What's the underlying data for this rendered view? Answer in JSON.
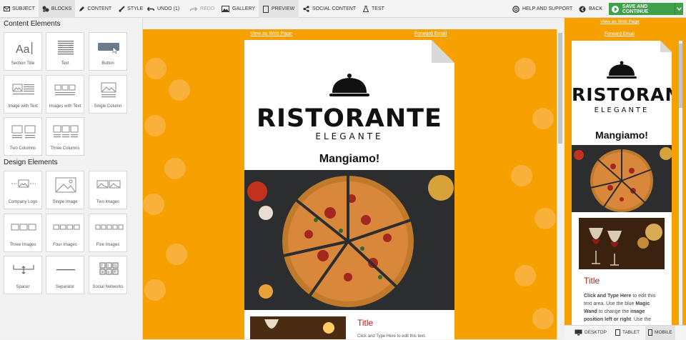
{
  "left_tabs": [
    {
      "label": "Subject",
      "icon": "envelope-icon"
    },
    {
      "label": "Blocks",
      "icon": "blocks-icon"
    },
    {
      "label": "Content",
      "icon": "pencil-icon"
    },
    {
      "label": "Style",
      "icon": "brush-icon"
    }
  ],
  "toolbar": {
    "undo": "Undo (1)",
    "redo": "Redo",
    "gallery": "Gallery",
    "preview": "Preview",
    "social": "Social Content",
    "test": "Test",
    "help": "Help and Support",
    "back": "Back",
    "save": "Save and Continue"
  },
  "sidebar": {
    "content_heading": "Content Elements",
    "content_blocks": [
      {
        "label": "Section Title",
        "icon": "section-title-icon"
      },
      {
        "label": "Text",
        "icon": "text-block-icon"
      },
      {
        "label": "Button",
        "icon": "button-block-icon"
      },
      {
        "label": "Image with Text",
        "icon": "image-with-text-icon"
      },
      {
        "label": "Images with Text",
        "icon": "images-with-text-icon"
      },
      {
        "label": "Single Column",
        "icon": "single-column-icon"
      },
      {
        "label": "Two Columns",
        "icon": "two-columns-icon"
      },
      {
        "label": "Three Columns",
        "icon": "three-columns-icon"
      }
    ],
    "design_heading": "Design Elements",
    "design_blocks": [
      {
        "label": "Company Logo",
        "icon": "company-logo-icon"
      },
      {
        "label": "Single Image",
        "icon": "single-image-icon"
      },
      {
        "label": "Two Images",
        "icon": "two-images-icon"
      },
      {
        "label": "Three Images",
        "icon": "three-images-icon"
      },
      {
        "label": "Four Images",
        "icon": "four-images-icon"
      },
      {
        "label": "Five Images",
        "icon": "five-images-icon"
      },
      {
        "label": "Spacer",
        "icon": "spacer-icon"
      },
      {
        "label": "Separator",
        "icon": "separator-icon"
      },
      {
        "label": "Social Networks",
        "icon": "social-networks-icon"
      }
    ]
  },
  "email": {
    "view_web": "View as Web Page",
    "forward": "Forward Email",
    "brand": "RISTORANTE",
    "brand_sub": "ELEGANTE",
    "heading": "Mangiamo!",
    "section_title": "Title",
    "body_desktop": "Click and Type Here to edit this text.",
    "body_parts": [
      "Click and Type Here",
      " to edit this text area. Use the blue ",
      "Magic Wand",
      " to change the ",
      "image position left or right",
      ". Use the"
    ]
  },
  "devices": [
    {
      "label": "Desktop",
      "icon": "desktop-icon"
    },
    {
      "label": "Tablet",
      "icon": "tablet-icon"
    },
    {
      "label": "Mobile",
      "icon": "mobile-icon"
    }
  ],
  "colors": {
    "accent_green": "#3fa14a",
    "background_orange": "#f7a100",
    "title_red": "#b32020"
  }
}
